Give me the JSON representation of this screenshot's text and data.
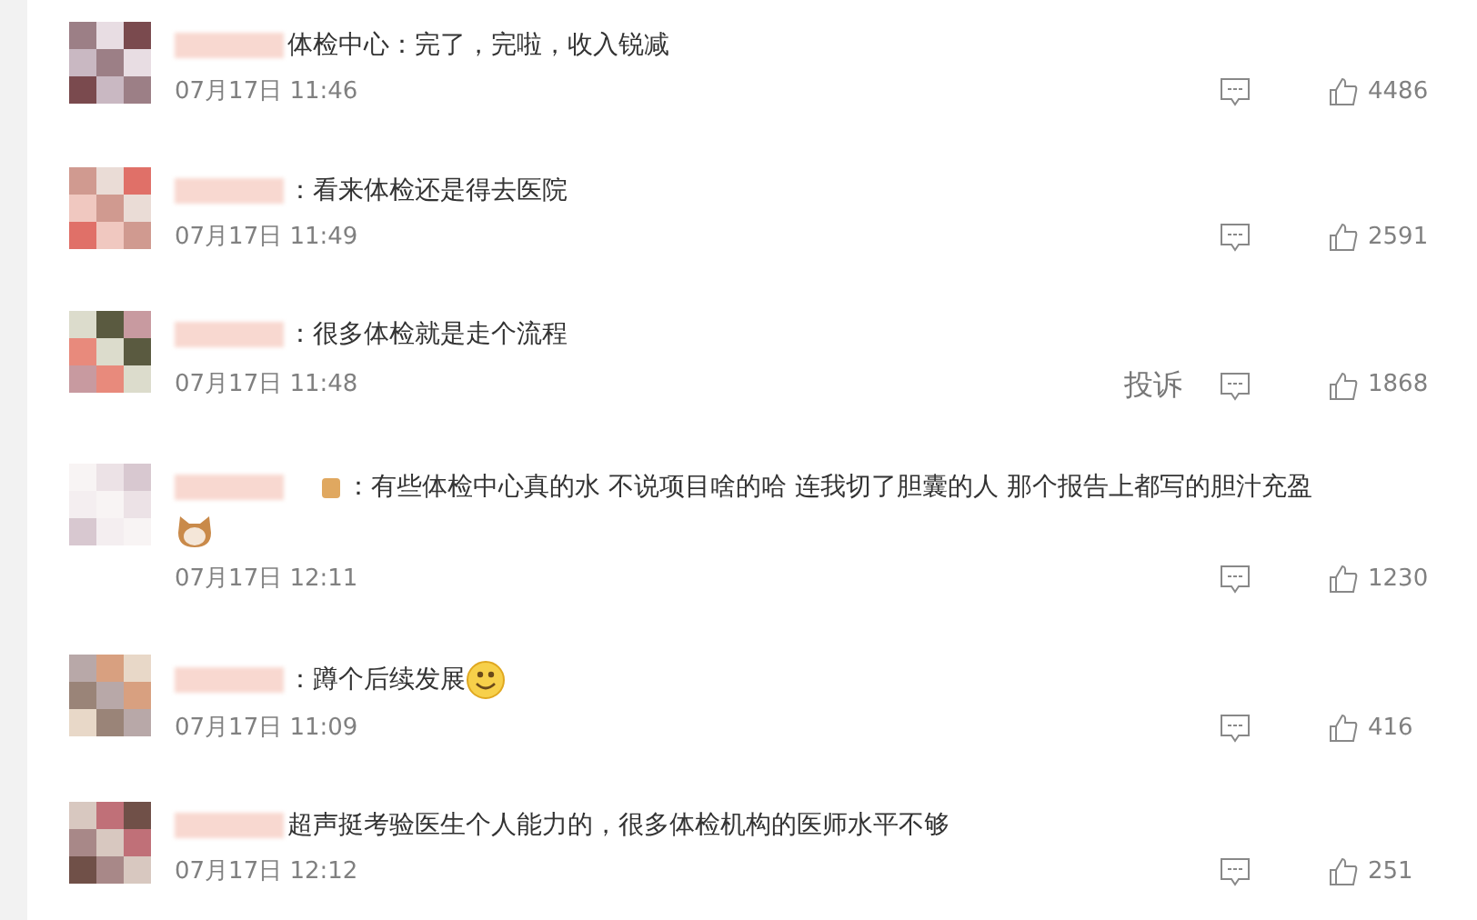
{
  "comments": [
    {
      "text": "体检中心：完了，完啦，收入锐减",
      "time": "07月17日 11:46",
      "likes": "4486"
    },
    {
      "text": "：看来体检还是得去医院",
      "time": "07月17日 11:49",
      "likes": "2591"
    },
    {
      "text": "：很多体检就是走个流程",
      "time": "07月17日 11:48",
      "likes": "1868",
      "report": "投诉"
    },
    {
      "text": "：有些体检中心真的水 不说项目啥的哈 连我切了胆囊的人 那个报告上都写的胆汁充盈",
      "time": "07月17日 12:11",
      "likes": "1230",
      "badge": true,
      "emoji_line": {
        "kind": "cat"
      }
    },
    {
      "text": "：蹲个后续发展",
      "time": "07月17日 11:09",
      "likes": "416",
      "trailing_emoji": {
        "kind": "smile"
      }
    },
    {
      "text": "超声挺考验医生个人能力的，很多体检机构的医师水平不够",
      "time": "07月17日 12:12",
      "likes": "251"
    }
  ]
}
